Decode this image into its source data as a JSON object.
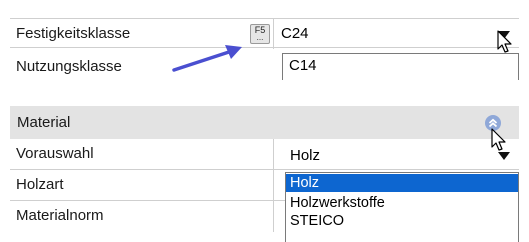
{
  "top_panel": {
    "row1_label": "Festigkeitsklasse",
    "f5_label": "F5",
    "f5_dots": "...",
    "row1_value": "C24",
    "row2_label": "Nutzungsklasse",
    "dropdown_option": "C14"
  },
  "bottom_panel": {
    "section_title": "Material",
    "rows": [
      {
        "label": "Vorauswahl",
        "value": "Holz"
      },
      {
        "label": "Holzart"
      },
      {
        "label": "Materialnorm"
      }
    ],
    "dropdown_options": [
      "Holz",
      "Holzwerkstoffe",
      "STEICO"
    ],
    "selected_option_index": 0
  },
  "icons": {
    "collapse": "chevron-double-up-icon",
    "dropdown": "triangle-down-icon",
    "cursor": "mouse-pointer-icon",
    "annotation": "arrow-icon"
  },
  "colors": {
    "selection": "#0d66d0",
    "header_bg": "#e3e3e3",
    "arrow": "#4a4fd0",
    "collapse_icon": "#8fa8d8"
  }
}
